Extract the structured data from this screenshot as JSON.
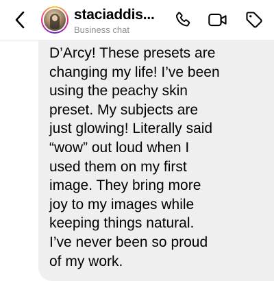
{
  "header": {
    "back_icon": "chevron-left-icon",
    "username": "staciaddis...",
    "subtitle": "Business chat",
    "actions": {
      "phone_icon": "phone-icon",
      "video_icon": "video-camera-icon",
      "tag_icon": "tag-icon"
    }
  },
  "message": {
    "text": "D’Arcy! These presets are\nchanging my life! I’ve been\nusing the peachy skin\npreset. My subjects are\njust glowing! Literally said\n“wow” out loud when I\nused them on my first\nimage. They bring more\njoy to my images while\nkeeping things natural.\nI’ve never been so proud\nof my work."
  },
  "colors": {
    "bubble_bg": "#efefef",
    "subtitle": "#8e8e8e",
    "text": "#000000"
  }
}
